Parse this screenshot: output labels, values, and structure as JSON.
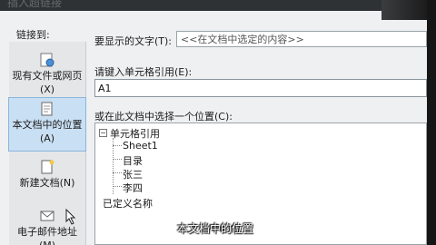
{
  "dialog": {
    "title": "插入超链接"
  },
  "sidebar": {
    "heading": "链接到:",
    "items": [
      {
        "label": "现有文件或网页(X)",
        "icon": "web-page-icon",
        "active": false
      },
      {
        "label": "本文档中的位置(A)",
        "icon": "document-place-icon",
        "active": true
      },
      {
        "label": "新建文档(N)",
        "icon": "new-document-icon",
        "active": false
      },
      {
        "label": "电子邮件地址(M)",
        "icon": "email-icon",
        "active": false
      }
    ]
  },
  "text_to_display": {
    "label": "要显示的文字(T):",
    "value": "<<在文档中选定的内容>>"
  },
  "cell_reference": {
    "label": "请键入单元格引用(E):",
    "value": "A1"
  },
  "location": {
    "label": "或在此文档中选择一个位置(C):",
    "tree": {
      "root": "单元格引用",
      "root_toggle": "−",
      "children": [
        "Sheet1",
        "目录",
        "张三",
        "李四"
      ],
      "defined_names": "已定义名称"
    }
  },
  "caption": "本文档中的位置"
}
